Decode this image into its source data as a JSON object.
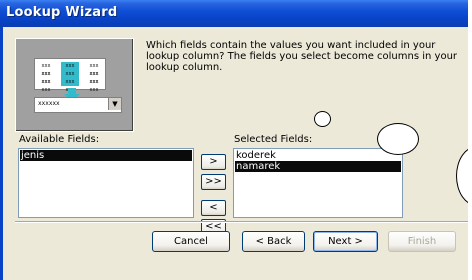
{
  "window": {
    "title": "Lookup Wizard"
  },
  "intro": {
    "text": "Which fields contain the values you want included in your lookup column? The fields you select become columns in your lookup column.",
    "image": {
      "grid_text": "xxx xxx",
      "dropdown_text": "xxxxxx",
      "accent": "#33bbcc"
    }
  },
  "available": {
    "label": "Available Fields:",
    "items": [
      "jenis"
    ]
  },
  "selected": {
    "label": "Selected Fields:",
    "items": [
      "koderek",
      "namarek"
    ]
  },
  "move_buttons": {
    "add_one": ">",
    "add_all": ">>",
    "remove_one": "<",
    "remove_all": "<<"
  },
  "buttons": {
    "cancel": "Cancel",
    "back": "< Back",
    "next": "Next >",
    "finish": "Finish"
  },
  "colors": {
    "selection": "#0a0a0a",
    "titlebar": "#0843c6",
    "dialog_bg": "#ece9d8"
  }
}
